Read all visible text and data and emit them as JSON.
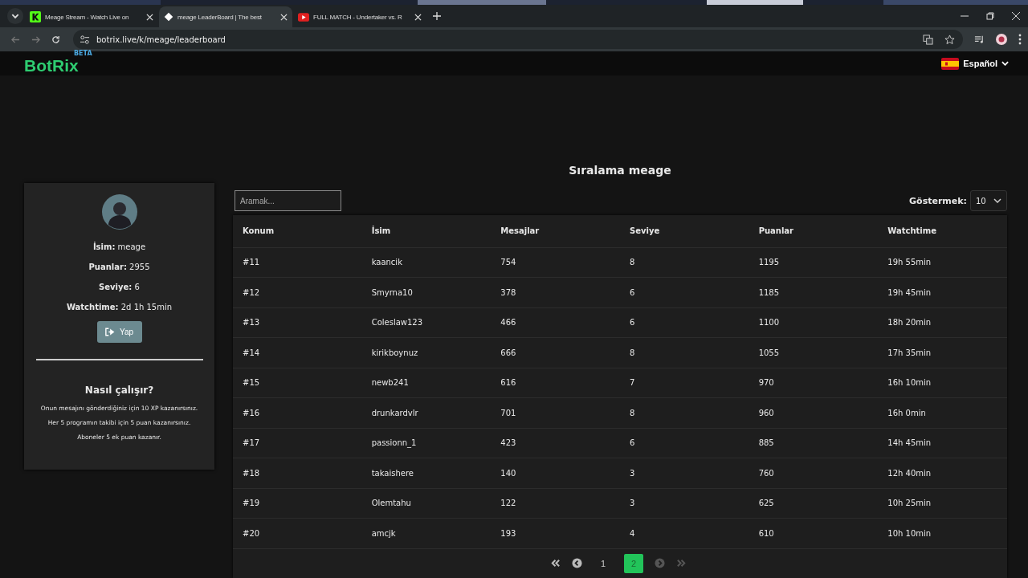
{
  "browser": {
    "tabs": [
      {
        "title": "Meage Stream - Watch Live on",
        "kind": "k",
        "selected": false
      },
      {
        "title": "meage LeaderBoard | The best",
        "kind": "diamond",
        "selected": true
      },
      {
        "title": "FULL MATCH - Undertaker vs. R",
        "kind": "play",
        "selected": false
      }
    ],
    "url": "botrix.live/k/meage/leaderboard"
  },
  "header": {
    "logo": "BotRix",
    "logo_badge": "BETA",
    "language": "Español"
  },
  "profile": {
    "fields": [
      {
        "label": "İsim:",
        "value": "meage"
      },
      {
        "label": "Puanlar:",
        "value": "2955"
      },
      {
        "label": "Seviye:",
        "value": "6"
      },
      {
        "label": "Watchtime:",
        "value": "2d 1h 15min"
      }
    ],
    "button": "Yap",
    "how_title": "Nasıl çalışır?",
    "how_lines": [
      "Onun mesajını gönderdiğiniz için 10 XP kazanırsınız.",
      "Her 5 programın takibi için 5 puan kazanırsınız.",
      "Aboneler 5 ek puan kazanır."
    ]
  },
  "leaderboard": {
    "title": "Sıralama meage",
    "search": {
      "placeholder": "Aramak..."
    },
    "show_label": "Göstermek:",
    "show_value": "10",
    "columns": [
      "Konum",
      "İsim",
      "Mesajlar",
      "Seviye",
      "Puanlar",
      "Watchtime"
    ],
    "rows": [
      [
        "#11",
        "kaancik",
        "754",
        "8",
        "1195",
        "19h 55min"
      ],
      [
        "#12",
        "Smyrna10",
        "378",
        "6",
        "1185",
        "19h 45min"
      ],
      [
        "#13",
        "Coleslaw123",
        "466",
        "6",
        "1100",
        "18h 20min"
      ],
      [
        "#14",
        "kirikboynuz",
        "666",
        "8",
        "1055",
        "17h 35min"
      ],
      [
        "#15",
        "newb241",
        "616",
        "7",
        "970",
        "16h 10min"
      ],
      [
        "#16",
        "drunkardvlr",
        "701",
        "8",
        "960",
        "16h 0min"
      ],
      [
        "#17",
        "passionn_1",
        "423",
        "6",
        "885",
        "14h 45min"
      ],
      [
        "#18",
        "takaishere",
        "140",
        "3",
        "760",
        "12h 40min"
      ],
      [
        "#19",
        "Olemtahu",
        "122",
        "3",
        "625",
        "10h 25min"
      ],
      [
        "#20",
        "amcjk",
        "193",
        "4",
        "610",
        "10h 10min"
      ]
    ],
    "pagination": {
      "first": {
        "disabled": false
      },
      "prev": {
        "disabled": false
      },
      "pages": [
        {
          "label": "1",
          "selected": false
        },
        {
          "label": "2",
          "selected": true
        }
      ],
      "next": {
        "disabled": true
      },
      "last": {
        "disabled": true
      }
    }
  }
}
